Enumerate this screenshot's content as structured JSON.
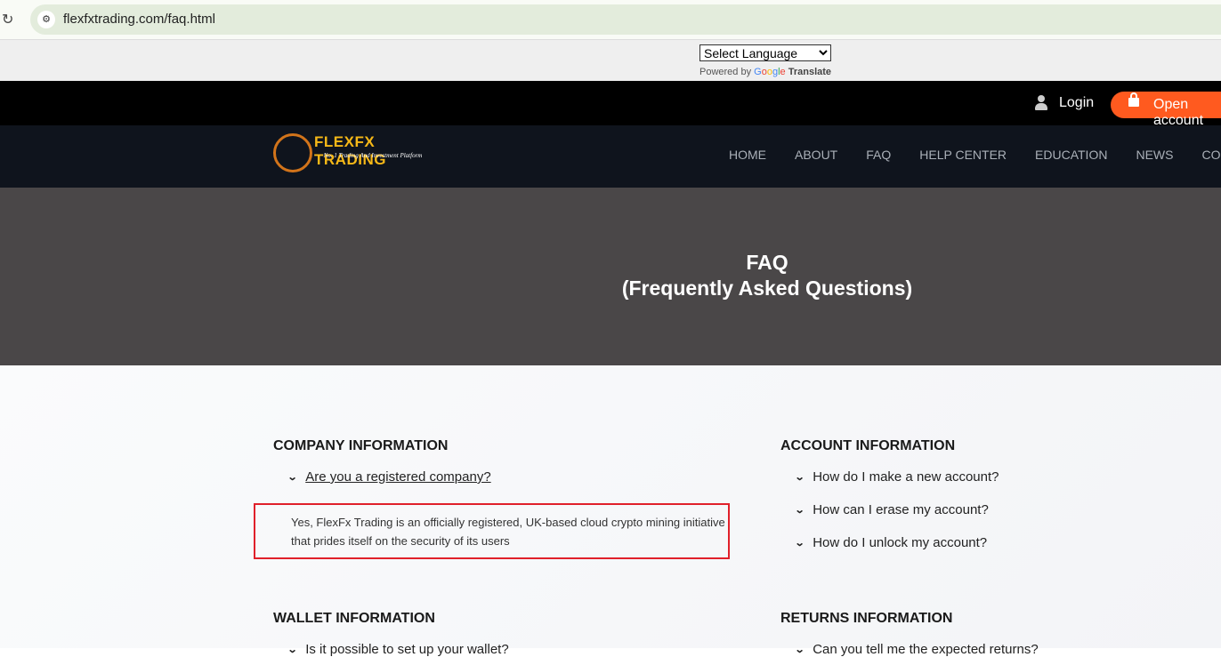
{
  "browser": {
    "url": "flexfxtrading.com/faq.html"
  },
  "translate": {
    "select_label": "Select Language",
    "powered_by": "Powered by",
    "google": [
      "G",
      "o",
      "o",
      "g",
      "l",
      "e"
    ],
    "translate": "Translate"
  },
  "topbar": {
    "login": "Login",
    "open_account": "Open account"
  },
  "logo": {
    "title": "FLEXFX TRADING",
    "subtitle": "No. 1 Trading And Investment Platform"
  },
  "nav": [
    "HOME",
    "ABOUT",
    "FAQ",
    "HELP CENTER",
    "EDUCATION",
    "NEWS",
    "CONTACT"
  ],
  "hero": {
    "title": "FAQ",
    "subtitle": "(Frequently Asked Questions)"
  },
  "sections": {
    "company": {
      "title": "COMPANY INFORMATION",
      "question": "Are you a registered company?",
      "answer": "Yes, FlexFx Trading is an officially registered, UK-based cloud crypto mining initiative that prides itself on the security of its users"
    },
    "account": {
      "title": "ACCOUNT INFORMATION",
      "questions": [
        "How do I make a new account?",
        "How can I erase my account?",
        "How do I unlock my account?"
      ]
    },
    "wallet": {
      "title": "WALLET INFORMATION",
      "questions": [
        "Is it possible to set up your wallet?"
      ]
    },
    "returns": {
      "title": "RETURNS INFORMATION",
      "questions": [
        "Can you tell me the expected returns?"
      ]
    }
  }
}
